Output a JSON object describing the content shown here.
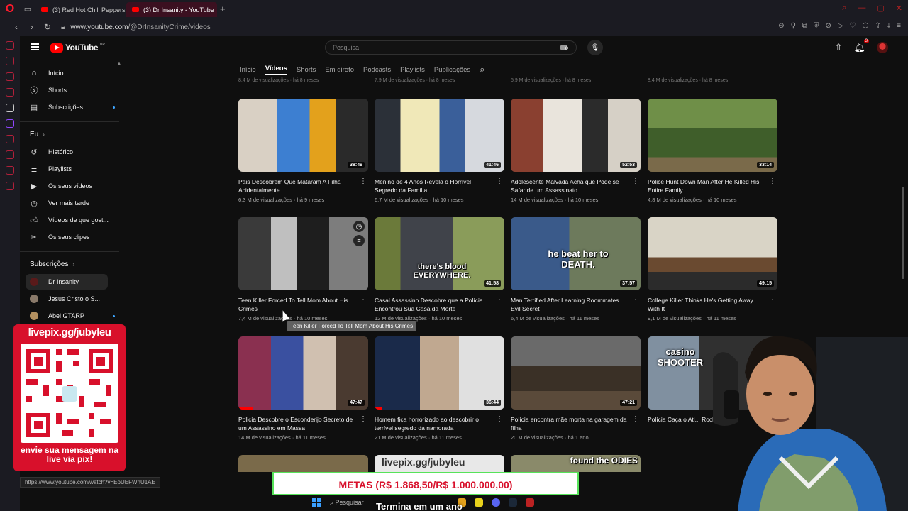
{
  "browser": {
    "tabs": [
      {
        "label": "(3) Red Hot Chili Peppers"
      },
      {
        "label": "(3) Dr Insanity - YouTube"
      }
    ],
    "url_host": "www.youtube.com",
    "url_path": "/@DrInsanityCrime/videos",
    "status_url": "https://www.youtube.com/watch?v=EoUEFWnU1AE"
  },
  "masthead": {
    "logo_text": "YouTube",
    "country": "BR",
    "search_placeholder": "Pesquisa",
    "notifications": "3"
  },
  "guide": {
    "main": [
      {
        "label": "Início",
        "icon": "home-icon"
      },
      {
        "label": "Shorts",
        "icon": "shorts-icon"
      },
      {
        "label": "Subscrições",
        "icon": "subscriptions-icon"
      }
    ],
    "you_heading": "Eu",
    "you": [
      {
        "label": "Histórico",
        "icon": "history-icon"
      },
      {
        "label": "Playlists",
        "icon": "playlists-icon"
      },
      {
        "label": "Os seus vídeos",
        "icon": "your-videos-icon"
      },
      {
        "label": "Ver mais tarde",
        "icon": "watch-later-icon"
      },
      {
        "label": "Vídeos de que gost...",
        "icon": "like-icon"
      },
      {
        "label": "Os seus clipes",
        "icon": "clips-icon"
      }
    ],
    "subs_heading": "Subscrições",
    "subs": [
      {
        "label": "Dr Insanity"
      },
      {
        "label": "Jesus Cristo o S..."
      },
      {
        "label": "Abel GTARP"
      }
    ]
  },
  "channel_tabs": [
    "Início",
    "Vídeos",
    "Shorts",
    "Em direto",
    "Podcasts",
    "Playlists",
    "Publicações"
  ],
  "prev_row_meta": [
    "8,4 M de visualizações · há 8 meses",
    "7,9 M de visualizações · há 8 meses",
    "5,9 M de visualizações · há 8 meses",
    "8,4 M de visualizações · há 8 meses"
  ],
  "videos": [
    {
      "title": "Pais Descobrem Que Mataram A Filha Acidentalmente",
      "meta": "6,3 M de visualizações · há 9 meses",
      "duration": "38:49",
      "progress": 0
    },
    {
      "title": "Menino de 4 Anos Revela o Horrível Segredo da Família",
      "meta": "6,7 M de visualizações · há 10 meses",
      "duration": "41:46",
      "progress": 0
    },
    {
      "title": "Adolescente Malvada Acha que Pode se Safar de um Assassinato",
      "meta": "14 M de visualizações · há 10 meses",
      "duration": "52:53",
      "progress": 0
    },
    {
      "title": "Police Hunt Down Man After He Killed His Entire Family",
      "meta": "4,8 M de visualizações · há 10 meses",
      "duration": "33:14",
      "progress": 0
    },
    {
      "title": "Teen Killer Forced To Tell Mom About His Crimes",
      "meta": "7,4 M de visualizações · há 10 meses",
      "duration": "",
      "progress": 0
    },
    {
      "title": "Casal Assassino Descobre que a Polícia Encontrou Sua Casa da Morte",
      "meta": "12 M de visualizações · há 10 meses",
      "duration": "41:58",
      "progress": 0,
      "caption": "there's blood EVERYWHERE."
    },
    {
      "title": "Man Terrified After Learning Roommates Evil Secret",
      "meta": "6,4 M de visualizações · há 11 meses",
      "duration": "37:57",
      "progress": 0,
      "caption": "he beat her to DEATH."
    },
    {
      "title": "College Killer Thinks He's Getting Away With It",
      "meta": "9,1 M de visualizações · há 11 meses",
      "duration": "49:15",
      "progress": 0
    },
    {
      "title": "Policia Descobre o Esconderijo Secreto de um Assassino em Massa",
      "meta": "14 M de visualizações · há 11 meses",
      "duration": "47:47",
      "progress": 0.11
    },
    {
      "title": "Homem fica horrorizado ao descobrir o terrível segredo da namorada",
      "meta": "21 M de visualizações · há 11 meses",
      "duration": "36:44",
      "progress": 0.06
    },
    {
      "title": "Polícia encontra mãe morta na garagem da filha",
      "meta": "20 M de visualizações · há 1 ano",
      "duration": "47:21",
      "progress": 0
    },
    {
      "title": "Polícia Caça o Ati... Rock",
      "meta": "",
      "duration": "",
      "progress": 0,
      "caption": "casino SHOOTER"
    }
  ],
  "tooltip": "Teen Killer Forced To Tell Mom About His Crimes",
  "overlay": {
    "qr_title": "livepix.gg/jubyleu",
    "qr_msg": "envie sua mensagem na live via pix!",
    "goal": "METAS (R$ 1.868,50/R$ 1.000.000,00)",
    "ticker": "Termina em um ano",
    "bottom_banner": "livepix.gg/jubyleu",
    "bottom_caption": "found the ODIES"
  },
  "taskbar": {
    "search": "Pesquisar"
  },
  "colors": {
    "accent": "#ff0000",
    "background": "#0f0f0f",
    "livepix_red": "#d8102b",
    "goal_border": "#57e35a"
  }
}
